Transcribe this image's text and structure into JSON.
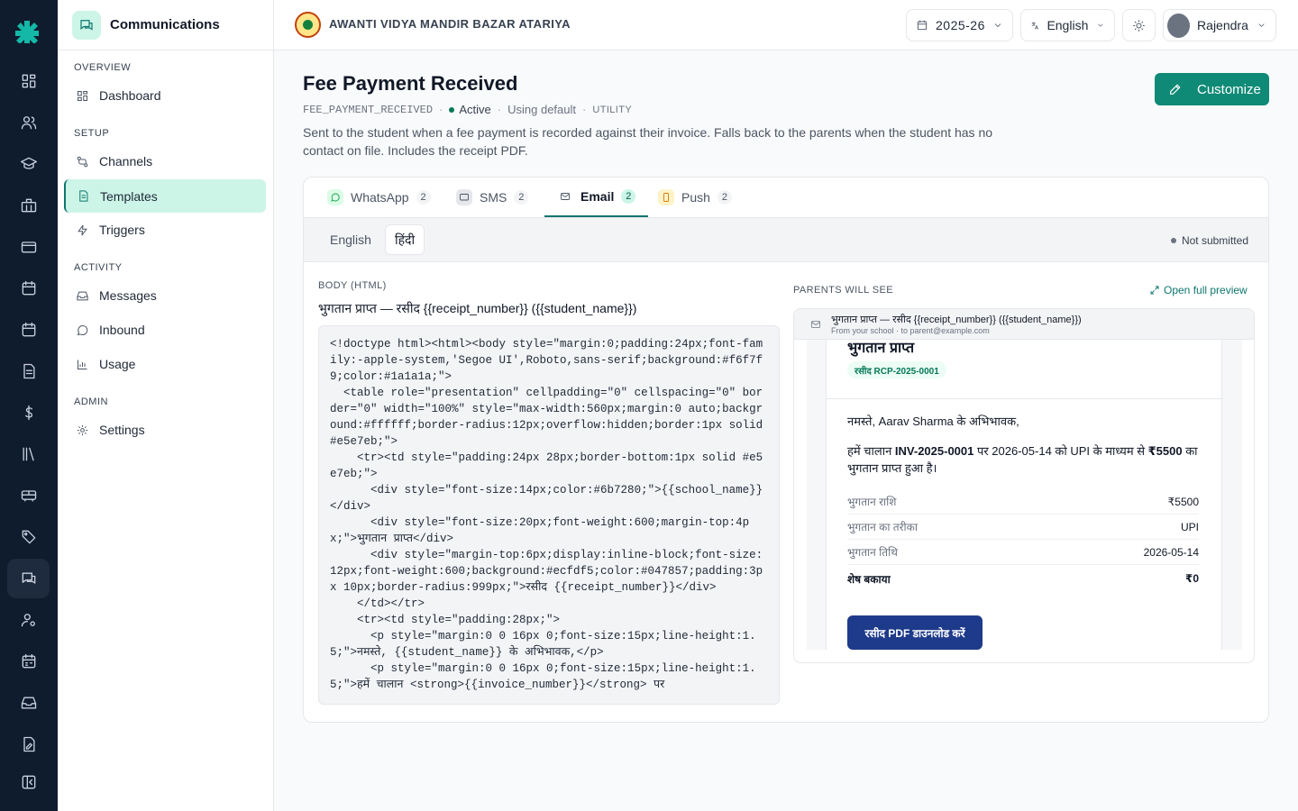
{
  "app": {
    "title": "Communications"
  },
  "rail": {
    "icons": [
      "logo-icon",
      "dashboard-icon",
      "users-icon",
      "graduation-cap-icon",
      "building-icon",
      "credit-card-icon",
      "calendar-icon",
      "calendar-check-icon",
      "document-icon",
      "dollar-icon",
      "library-icon",
      "bus-icon",
      "tag-icon",
      "chat-icon",
      "user-settings-icon",
      "calendar-grid-icon",
      "inbox-icon",
      "file-edit-icon",
      "collapse-icon"
    ],
    "active": "chat-icon"
  },
  "sidebar": {
    "sections": [
      {
        "label": "OVERVIEW",
        "items": [
          {
            "label": "Dashboard",
            "icon": "dashboard-icon"
          }
        ]
      },
      {
        "label": "SETUP",
        "items": [
          {
            "label": "Channels",
            "icon": "channels-icon"
          },
          {
            "label": "Templates",
            "icon": "document-icon",
            "active": true
          },
          {
            "label": "Triggers",
            "icon": "bolt-icon"
          }
        ]
      },
      {
        "label": "ACTIVITY",
        "items": [
          {
            "label": "Messages",
            "icon": "inbox-icon"
          },
          {
            "label": "Inbound",
            "icon": "message-circle-icon"
          },
          {
            "label": "Usage",
            "icon": "bar-chart-icon"
          }
        ]
      },
      {
        "label": "ADMIN",
        "items": [
          {
            "label": "Settings",
            "icon": "gear-icon"
          }
        ]
      }
    ]
  },
  "topbar": {
    "school_name": "AWANTI VIDYA MANDIR BAZAR ATARIYA",
    "year": "2025-26",
    "language": "English",
    "user": "Rajendra"
  },
  "page": {
    "title": "Fee Payment Received",
    "code": "FEE_PAYMENT_RECEIVED",
    "status": "Active",
    "source": "Using default",
    "category": "UTILITY",
    "description": "Sent to the student when a fee payment is recorded against their invoice. Falls back to the parents when the student has no contact on file. Includes the receipt PDF.",
    "customize_label": "Customize"
  },
  "tabs": [
    {
      "label": "WhatsApp",
      "count": "2",
      "icon": "whatsapp-icon",
      "color": "#16a34a"
    },
    {
      "label": "SMS",
      "count": "2",
      "icon": "sms-icon",
      "color": "#2563eb"
    },
    {
      "label": "Email",
      "count": "2",
      "icon": "mail-icon",
      "color": "#4b5563",
      "active": true
    },
    {
      "label": "Push",
      "count": "2",
      "icon": "push-icon",
      "color": "#d97706"
    }
  ],
  "languages": {
    "english": "English",
    "hindi": "हिंदी",
    "status": "Not submitted"
  },
  "editor": {
    "body_label": "BODY (HTML)",
    "subject": "भुगतान प्राप्त — रसीद {{receipt_number}} ({{student_name}})",
    "code": "<!doctype html><html><body style=\"margin:0;padding:24px;font-family:-apple-system,'Segoe UI',Roboto,sans-serif;background:#f6f7f9;color:#1a1a1a;\">\n  <table role=\"presentation\" cellpadding=\"0\" cellspacing=\"0\" border=\"0\" width=\"100%\" style=\"max-width:560px;margin:0 auto;background:#ffffff;border-radius:12px;overflow:hidden;border:1px solid #e5e7eb;\">\n    <tr><td style=\"padding:24px 28px;border-bottom:1px solid #e5e7eb;\">\n      <div style=\"font-size:14px;color:#6b7280;\">{{school_name}}</div>\n      <div style=\"font-size:20px;font-weight:600;margin-top:4px;\">भुगतान प्राप्त</div>\n      <div style=\"margin-top:6px;display:inline-block;font-size:12px;font-weight:600;background:#ecfdf5;color:#047857;padding:3px 10px;border-radius:999px;\">रसीद {{receipt_number}}</div>\n    </td></tr>\n    <tr><td style=\"padding:28px;\">\n      <p style=\"margin:0 0 16px 0;font-size:15px;line-height:1.5;\">नमस्ते, {{student_name}} के अभिभावक,</p>\n      <p style=\"margin:0 0 16px 0;font-size:15px;line-height:1.5;\">हमें चालान <strong>{{invoice_number}}</strong> पर"
  },
  "preview": {
    "label": "PARENTS WILL SEE",
    "open_label": "Open full preview",
    "subject": "भुगतान प्राप्त — रसीद {{receipt_number}} ({{student_name}})",
    "from": "From your school · to parent@example.com",
    "mail_title": "भुगतान प्राप्त",
    "receipt_badge": "रसीद RCP-2025-0001",
    "greeting": "नमस्ते, Aarav Sharma के अभिभावक,",
    "msg_1": "हमें चालान ",
    "msg_invoice": "INV-2025-0001",
    "msg_2": " पर 2026-05-14 को UPI के माध्यम से ",
    "msg_amount": "₹5500",
    "msg_3": " का भुगतान प्राप्त हुआ है।",
    "rows": [
      {
        "k": "भुगतान राशि",
        "v": "₹5500"
      },
      {
        "k": "भुगतान का तरीका",
        "v": "UPI"
      },
      {
        "k": "भुगतान तिथि",
        "v": "2026-05-14"
      },
      {
        "k": "शेष बकाया",
        "v": "₹0"
      }
    ],
    "download_label": "रसीद PDF डाउनलोड करें"
  }
}
